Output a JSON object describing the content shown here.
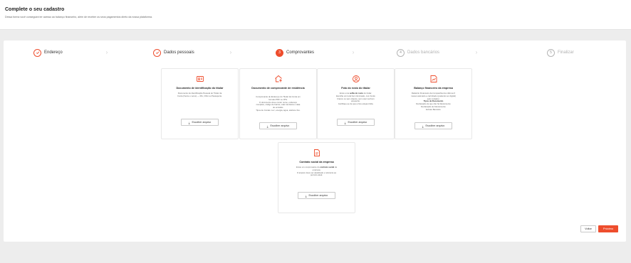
{
  "header": {
    "title": "Complete o seu cadastro",
    "subtitle": "Dessa forma você conseguirá ter acesso ao balanço financeiro, além de receber os seus pagamentos direto da nossa plataforma."
  },
  "stepper": {
    "steps": [
      {
        "number": "1",
        "label": "Endereço",
        "state": "done"
      },
      {
        "number": "2",
        "label": "Dados pessoais",
        "state": "done"
      },
      {
        "number": "3",
        "label": "Comprovantes",
        "state": "active"
      },
      {
        "number": "4",
        "label": "Dados bancários",
        "state": "todo"
      },
      {
        "number": "5",
        "label": "Finalizar",
        "state": "todo"
      }
    ]
  },
  "cards": [
    {
      "icon": "id-card-icon",
      "title": "Documento de identificação do titular",
      "desc": [
        "Documento de Identificação Pessoal do Titular da",
        "Conta (frente e verso) — RG, CNH ou Passaporte."
      ],
      "button": "Escolher arquivo"
    },
    {
      "icon": "house-upload-icon",
      "title": "Documento de comprovante de residência",
      "desc": [
        "Comprovante de Endereço do Titular da Conta em",
        "formato PDF ou JPG.",
        "O documento deve conter nome, endereço",
        "completo, código de barras, valor da fatura e data",
        "de emissão.",
        "Tipos de Contas: Luz, energia, água, telefone fixo."
      ],
      "button": "Escolher arquivo"
    },
    {
      "icon": "face-icon",
      "title": "Foto do rosto do titular",
      "desc_pre": "Envie uma ",
      "desc_bold": "selfie do rosto",
      "desc_post": " do titular.",
      "desc": [
        "Escolha um local bem iluminado, com fundo",
        "branco ou sem objetos, sem usar nenhum",
        "acessório.",
        "Certifique-se de que a foto esteja nítida."
      ],
      "button": "Escolher arquivo"
    },
    {
      "icon": "chart-file-icon",
      "title": "Balanço financeiro da empresa",
      "desc": [
        "Relatório Financeiro da Companhia dos últimos 6",
        "meses assinado e carimbado (podendo ser digital)",
        "pelo contador."
      ],
      "desc_bold": "Tipos de Documento",
      "desc2": [
        "Declaração de que não há faturamento",
        "Declaração de Faturamento",
        "Extrato Bancário"
      ],
      "button": "Escolher arquivo"
    },
    {
      "icon": "contract-icon",
      "title": "Contrato social da empresa",
      "desc_pre": "Envie um comprovante do ",
      "desc_bold": "contrato social",
      "desc_post": " da",
      "desc": [
        "empresa.",
        "O arquivo deve ser atualizado e referente ao",
        "período atual."
      ],
      "button": "Escolher arquivo"
    }
  ],
  "footer": {
    "back_label": "Voltar",
    "next_label": "Próximo"
  },
  "colors": {
    "accent": "#ee4d2d",
    "background": "#ededed",
    "muted": "#b0b0b0"
  }
}
